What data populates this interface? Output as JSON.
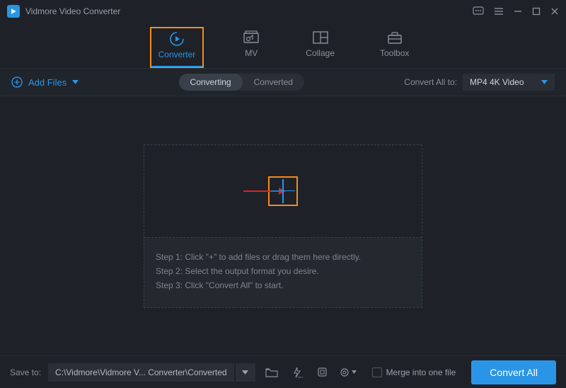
{
  "app": {
    "title": "Vidmore Video Converter"
  },
  "tabs": [
    {
      "label": "Converter",
      "active": true
    },
    {
      "label": "MV",
      "active": false
    },
    {
      "label": "Collage",
      "active": false
    },
    {
      "label": "Toolbox",
      "active": false
    }
  ],
  "toolbar": {
    "add_files": "Add Files",
    "segments": {
      "converting": "Converting",
      "converted": "Converted"
    },
    "convert_all_to_label": "Convert All to:",
    "format_selected": "MP4 4K Video"
  },
  "steps": {
    "s1": "Step 1: Click \"+\" to add files or drag them here directly.",
    "s2": "Step 2: Select the output format you desire.",
    "s3": "Step 3: Click \"Convert All\" to start."
  },
  "bottom": {
    "save_to_label": "Save to:",
    "path": "C:\\Vidmore\\Vidmore V... Converter\\Converted",
    "merge_label": "Merge into one file",
    "convert_all_btn": "Convert All"
  }
}
